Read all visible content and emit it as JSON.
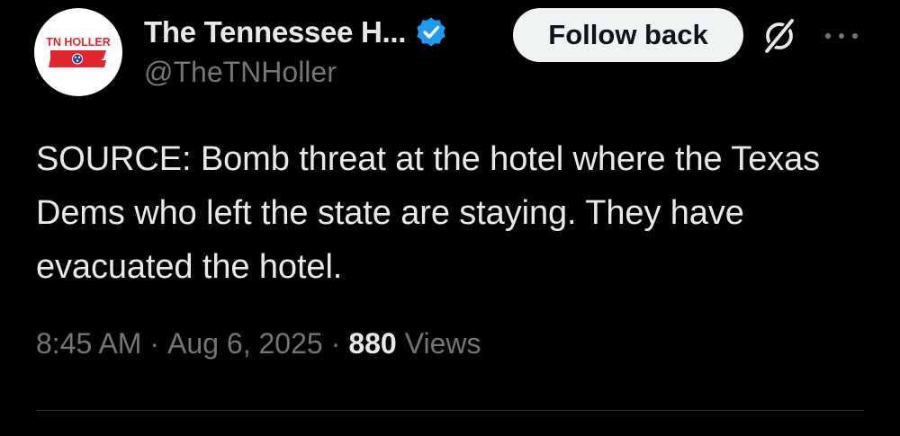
{
  "author": {
    "display_name": "The Tennessee H...",
    "handle": "@TheTNHoller",
    "avatar_text": "TN HOLLER",
    "verified": true
  },
  "actions": {
    "follow_label": "Follow back",
    "grok_icon": "grok-icon",
    "more_icon": "more-icon"
  },
  "tweet": {
    "text": "SOURCE: Bomb threat at the hotel where the Texas Dems who left the state are staying. They have evacuated the hotel.",
    "time": "8:45 AM",
    "separator": "·",
    "date": "Aug 6, 2025",
    "views_count": "880",
    "views_label": "Views"
  },
  "colors": {
    "background": "#000000",
    "primary_text": "#e7e9ea",
    "secondary_text": "#71767b",
    "verified_blue": "#1d9bf0",
    "button_bg": "#eff3f4",
    "logo_red": "#e0262f",
    "logo_blue": "#2a3f8f",
    "divider": "#2f3336"
  }
}
